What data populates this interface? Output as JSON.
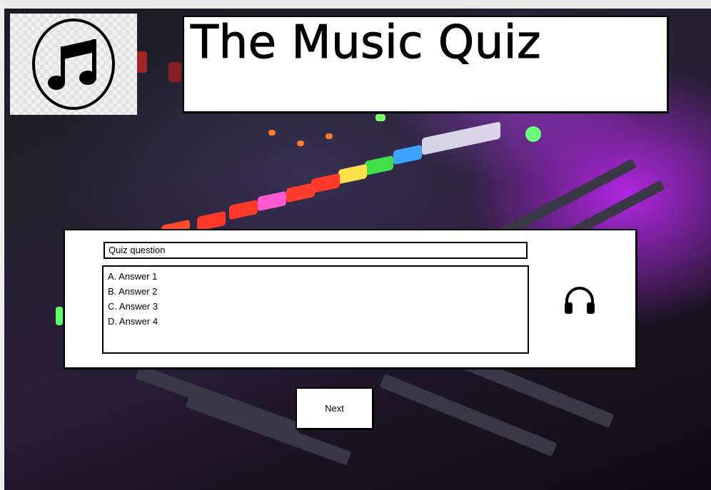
{
  "header": {
    "title": "The Music Quiz",
    "logo_icon": "music-note-icon"
  },
  "quiz": {
    "question": "Quiz question",
    "answers": [
      "A. Answer 1",
      "B. Answer 2",
      "C. Answer 3",
      "D. Answer 4"
    ],
    "audio_icon": "headphones-icon"
  },
  "controls": {
    "next_label": "Next"
  },
  "colors": {
    "panel_bg": "#ffffff",
    "border": "#000000",
    "background_accent": "#b428ff"
  }
}
